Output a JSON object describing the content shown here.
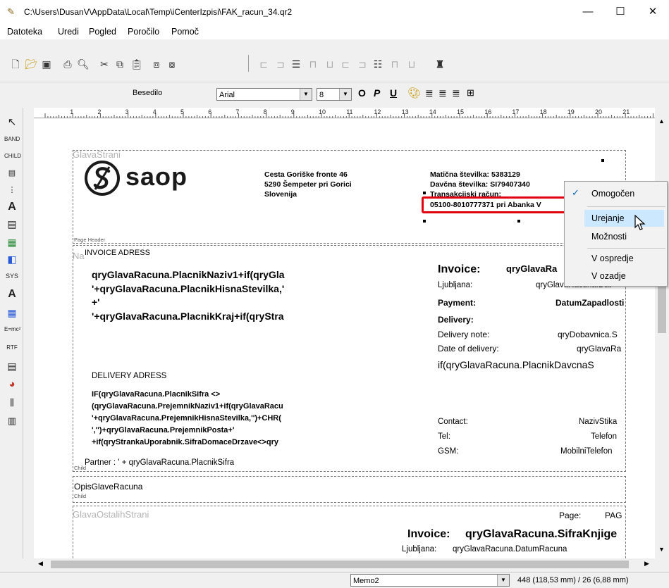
{
  "window": {
    "title": "C:\\Users\\DusanV\\AppData\\Local\\Temp\\iCenterIzpisi\\FAK_racun_34.qr2",
    "minimize": "—",
    "maximize": "☐",
    "close": "✕"
  },
  "menu": [
    "Datoteka",
    "Uredi",
    "Pogled",
    "Poročilo",
    "Pomoč"
  ],
  "format_toolbar": {
    "style_label": "Besedilo",
    "font": "Arial",
    "size": "8",
    "bold": "O",
    "italic": "P",
    "underline": "U"
  },
  "ruler": [
    "1",
    "2",
    "3",
    "4",
    "5",
    "6",
    "7",
    "8",
    "9",
    "10",
    "11",
    "12",
    "13",
    "14",
    "15",
    "16",
    "17",
    "18",
    "19",
    "20",
    "21"
  ],
  "palette": [
    "↖",
    "BAND",
    "CHILD",
    "",
    "",
    "A",
    "",
    "",
    "",
    "SYS",
    "A",
    "",
    "E=mc²",
    "RTF",
    "",
    "",
    "",
    ""
  ],
  "report": {
    "header_band_name": "GlavaStrani",
    "header_band_label": "Page Header",
    "logo_text": "saop",
    "company_address": [
      "Cesta Goriške fronte 46",
      "5290 Šempeter pri Gorici",
      "Slovenija"
    ],
    "reg_lines": [
      "Matična številka: 5383129",
      "Davčna številka: SI79407340",
      "Transakcijski račun:"
    ],
    "bank_account": "05100-8010777371 pri Abanka V",
    "child1_name": "Na",
    "child_label": "Child",
    "invoice_adress": "INVOICE ADRESS",
    "placnik_lines": [
      "qryGlavaRacuna.PlacnikNaziv1+if(qryGla",
      "'+qryGlavaRacuna.PlacnikHisnaStevilka,'",
      "+'",
      "'+qryGlavaRacuna.PlacnikKraj+if(qryStra"
    ],
    "invoice_title": "Invoice:",
    "invoice_ref": "qryGlavaRa",
    "ljubljana": "Ljubljana:",
    "ljubljana_val": "qryGlavaRacuna.Dat",
    "payment": "Payment:",
    "payment_val": "DatumZapadlosti",
    "delivery": "Delivery:",
    "delivery_note": "Delivery note:",
    "delivery_note_val": "qryDobavnica.S",
    "date_of_delivery": "Date of delivery:",
    "date_of_delivery_val": "qryGlavaRa",
    "davcna_expr": "if(qryGlavaRacuna.PlacnikDavcnaS",
    "delivery_adress": "DELIVERY ADRESS",
    "delivery_lines": [
      "IF(qryGlavaRacuna.PlacnikSifra <>",
      "(qryGlavaRacuna.PrejemnikNaziv1+if(qryGlavaRacu",
      "'+qryGlavaRacuna.PrejemnikHisnaStevilka,'')+CHR(",
      "','')+qryGlavaRacuna.PrejemnikPosta+'",
      "+if(qryStrankaUporabnik.SifraDomaceDrzave<>qry"
    ],
    "contact": "Contact:",
    "contact_val": "NazivStika",
    "tel": "Tel:",
    "tel_val": "Telefon",
    "gsm": "GSM:",
    "gsm_val": "MobilniTelefon",
    "partner": "Partner  : ' + qryGlavaRacuna.PlacnikSifra",
    "opis": "OpisGlaveRacuna",
    "ostale_name": "GlavaOstalihStrani",
    "page": "Page:",
    "page_val": "PAG",
    "invoice2": "Invoice:",
    "invoice2_val": "qryGlavaRacuna.SifraKnjige",
    "ljubljana2": "Ljubljana:",
    "ljubljana2_val": "qryGlavaRacuna.DatumRacuna"
  },
  "context_menu": {
    "items": [
      "Omogočen",
      "Urejanje",
      "Možnosti",
      "V ospredje",
      "V ozadje"
    ],
    "checked": "Omogočen",
    "highlighted": "Urejanje"
  },
  "status": {
    "component": "Memo2",
    "position": "448 (118,53 mm)  / 26 (6,88 mm)"
  },
  "colors": {
    "highlight_frame": "#e3000f",
    "menu_highlight": "#cce8ff",
    "check": "#0067c0",
    "logo": "#1a1a1a"
  }
}
